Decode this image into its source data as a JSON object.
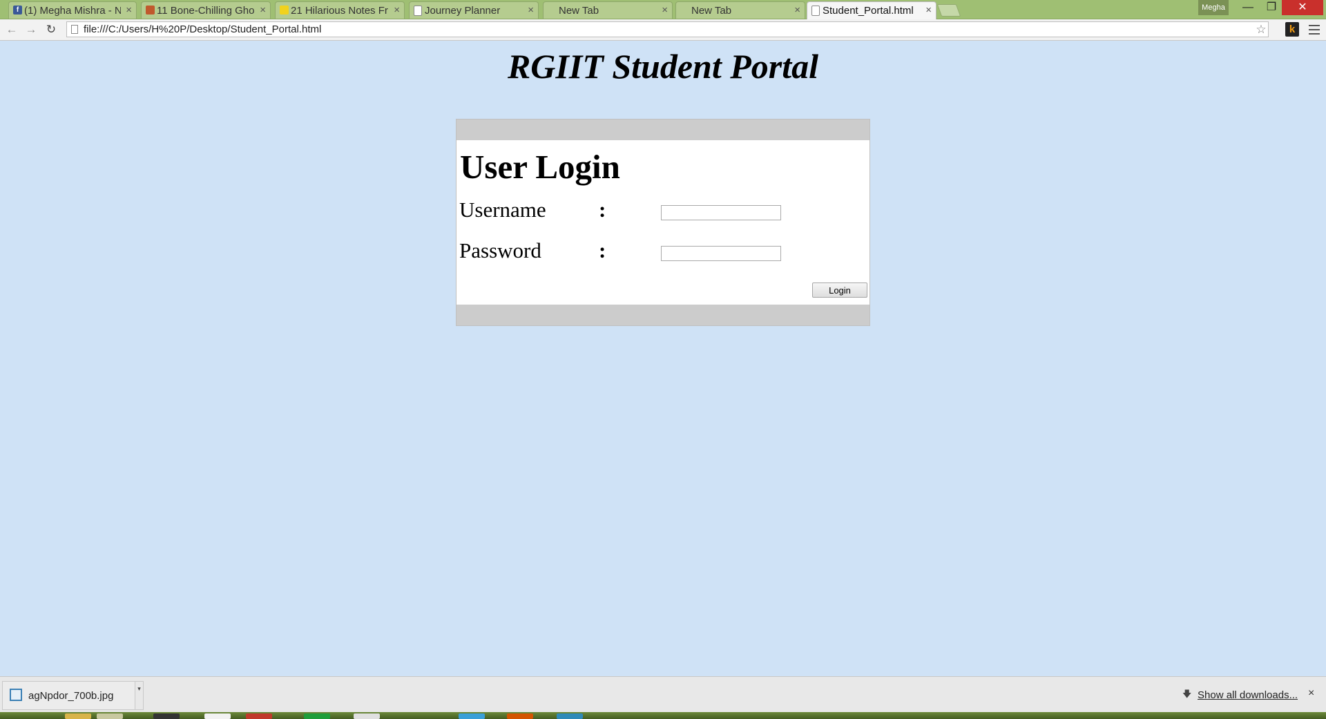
{
  "browser": {
    "tabs": [
      {
        "label": "(1) Megha Mishra - N",
        "icon": "facebook-icon",
        "icon_color": "#3b5998"
      },
      {
        "label": "11 Bone-Chilling Gho",
        "icon": "site-icon",
        "icon_color": "#c0592d"
      },
      {
        "label": "21 Hilarious Notes Fr",
        "icon": "site-icon",
        "icon_color": "#f1d21d"
      },
      {
        "label": "Journey Planner",
        "icon": "page-icon",
        "icon_color": "#ffffff"
      },
      {
        "label": "New Tab",
        "icon": "",
        "icon_color": ""
      },
      {
        "label": "New Tab",
        "icon": "",
        "icon_color": ""
      },
      {
        "label": "Student_Portal.html",
        "icon": "page-icon",
        "icon_color": "#ffffff",
        "active": true
      }
    ],
    "tab_close_glyph": "×",
    "profile_name": "Megha",
    "address": "file:///C:/Users/H%20P/Desktop/Student_Portal.html"
  },
  "page": {
    "title": "RGIIT Student Portal",
    "background_color": "#cfe2f6",
    "login": {
      "heading": "User Login",
      "username_label": "Username",
      "password_label": "Password",
      "colon": ":",
      "username_value": "",
      "password_value": "",
      "button_label": "Login"
    }
  },
  "downloads": {
    "file_name": "agNpdor_700b.jpg",
    "show_all_label": "Show all downloads...",
    "close_glyph": "×"
  }
}
